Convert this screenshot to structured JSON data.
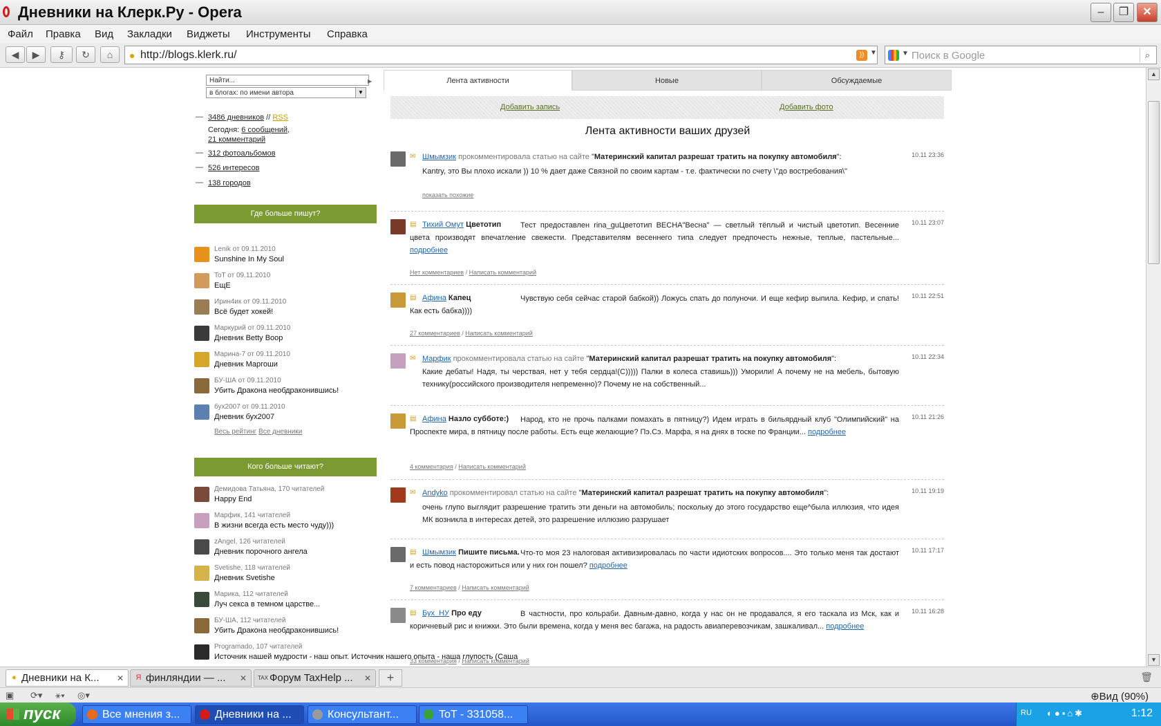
{
  "window": {
    "title": "Дневники на Клерк.Ру - Opera",
    "min": "–",
    "max": "❐",
    "close": "✕"
  },
  "menu": [
    "Файл",
    "Правка",
    "Вид",
    "Закладки",
    "Виджеты",
    "Инструменты",
    "Справка"
  ],
  "address": {
    "url": "http://blogs.klerk.ru/",
    "search_placeholder": "Поиск в Google"
  },
  "sidebar": {
    "search_placeholder": "Найти...",
    "search_mode": "в блогах: по имени автора",
    "stats": {
      "diaries": "3486 дневников",
      "sep": "//",
      "rss": "RSS",
      "today_label": "Сегодня:",
      "today_msgs": "6 сообщений",
      "today_comments": "21 комментарий",
      "albums": "312 фотоальбомов",
      "interests": "526 интересов",
      "cities": "138 городов"
    },
    "most_writing": {
      "title": "Где больше пишут?",
      "items": [
        {
          "meta": "Lenik от 09.11.2010",
          "title": "Sunshine In My Soul",
          "color": "#e8901c"
        },
        {
          "meta": "ToT от 09.11.2010",
          "title": "ЕщЕ",
          "color": "#d39a5e"
        },
        {
          "meta": "Ирин4ик от 09.11.2010",
          "title": "Всё будет хокей!",
          "color": "#9b7d55"
        },
        {
          "meta": "Маркурий от 09.11.2010",
          "title": "Дневник Betty Boop",
          "color": "#3a3a3a"
        },
        {
          "meta": "Марина-7 от 09.11.2010",
          "title": "Дневник Маргоши",
          "color": "#d9a52a"
        },
        {
          "meta": "БУ-ША от 09.11.2010",
          "title": "Убить Дракона необдраконившись!",
          "color": "#8a6a3a"
        },
        {
          "meta": "бух2007 от 09.11.2010",
          "title": "Дневник бух2007",
          "color": "#5a7fb0"
        }
      ],
      "links": [
        "Весь рейтинг",
        "Все дневники"
      ]
    },
    "most_read": {
      "title": "Кого больше читают?",
      "items": [
        {
          "meta": "Демидова Татьяна, 170 читателей",
          "title": "Happy End",
          "color": "#7a4a3a"
        },
        {
          "meta": "Марфик, 141 читателей",
          "title": "В жизни всегда есть место чуду)))",
          "color": "#c7a0c0"
        },
        {
          "meta": "zAngel, 126 читателей",
          "title": "Дневник порочного ангела",
          "color": "#4a4a4a"
        },
        {
          "meta": "Svetishe, 118 читателей",
          "title": "Дневник Svetishe",
          "color": "#d6b24a"
        },
        {
          "meta": "Марика, 112 читателей",
          "title": "Луч секса в темном царстве...",
          "color": "#3a4a3a"
        },
        {
          "meta": "БУ-ША, 112 читателей",
          "title": "Убить Дракона необдраконившись!",
          "color": "#8a6a3a"
        },
        {
          "meta": "Programado, 107 читателей",
          "title": "Источник нашей мудрости - наш опыт. Источник нашего опыта - наша глупость (Саша",
          "color": "#2a2a2a"
        }
      ]
    }
  },
  "feed": {
    "tabs": [
      "Лента активности",
      "Новые",
      "Обсуждаемые"
    ],
    "add_post": "Добавить запись",
    "add_photo": "Добавить фото",
    "title": "Лента активности ваших друзей",
    "posts": [
      {
        "author": "Шмымзик",
        "action": "прокомментировала статью на сайте",
        "subject": "Материнский капитал разрешат тратить на покупку автомобиля",
        "time": "10.11 23:36",
        "body": "Kantry, это Вы плохо искали )) 10 % дает даже Связной по своим картам - т.е. фактически по счету \\\"до востребования\\\"",
        "foot1": "показать похожие",
        "color": "#6a6a6a"
      },
      {
        "author": "Тихий Омут",
        "post_title": "Цветотип",
        "time": "10.11 23:07",
        "body": "Тест предоставлен rina_guЦветотип ВЕСНА\"Весна\" — светлый тёплый и чистый цветотип. Весенние цвета производят впечатление свежести. Представителям весеннего типа следует предпочесть нежные, теплые, пастельные...",
        "more": "подробнее",
        "foot1": "Нет комментариев",
        "foot2": "Написать комментарий",
        "color": "#7a3a2a"
      },
      {
        "author": "Афина",
        "post_title": "Капец",
        "time": "10.11 22:51",
        "body": "Чувствую себя сейчас старой бабкой)) Ложусь спать до полуночи. И еще кефир выпила. Кефир, и спать! Как есть бабка))))",
        "foot1": "27 комментариев",
        "foot2": "Написать комментарий",
        "color": "#c89a3a"
      },
      {
        "author": "Марфик",
        "action": "прокомментировала статью на сайте",
        "subject": "Материнский капитал разрешат тратить на покупку автомобиля",
        "time": "10.11 22:34",
        "body": "Какие дебаты! Надя, ты черствая, нет у тебя сердца!(С))))) Палки в колеса ставишь))) Уморили! А почему не на мебель, бытовую технику(российского производителя непременно)? Почему не на собственный...",
        "color": "#c7a0c0"
      },
      {
        "author": "Афина",
        "post_title": "Назло субботе:)",
        "time": "10.11 21:26",
        "body": "Народ, кто не прочь палками помахать в пятницу?) Идем играть в бильярдный клуб \"Олимпийский\" на Проспекте мира, в пятницу после работы. Есть еще желающие? Пэ.Сэ. Марфа, я на днях в тоске по Франции...",
        "more": "подробнее",
        "foot1": "4 комментария",
        "foot2": "Написать комментарий",
        "color": "#c89a3a"
      },
      {
        "author": "Andyko",
        "action": "прокомментировал статью на сайте",
        "subject": "Материнский капитал разрешат тратить на покупку автомобиля",
        "time": "10.11 19:19",
        "body": "очень глупо выглядит разрешение тратить эти деньги на автомобиль; поскольку до этого государство еще^была иллюзия, что идея МК возникла в интересах детей, это разрешение иллюзию разрушает",
        "color": "#a03a1a"
      },
      {
        "author": "Шмымзик",
        "post_title": "Пишите письма.",
        "time": "10.11 17:17",
        "body": "Что-то моя 23 налоговая активизировалась по части идиотских вопросов.... Это только меня так достают и есть повод насторожиться или у них гон пошел?",
        "more": "подробнее",
        "foot1": "7 комментариев",
        "foot2": "Написать комментарий",
        "color": "#6a6a6a"
      },
      {
        "author": "Бух_НУ",
        "post_title": "Про еду",
        "time": "10.11 16:28",
        "body": "В частности, про кольраби. Давным-давно, когда у нас он не продавался, я его таскала из Мск, как и коричневый рис и книжки. Это были времена, когда у меня вес багажа, на радость авиаперевозчикам, зашкаливал...",
        "more": "подробнее",
        "foot1": "33 комментария",
        "foot2": "Написать комментарий",
        "color": "#8a8a8a"
      }
    ]
  },
  "browser_tabs": [
    {
      "label": "Дневники на К...",
      "icon": "#e0a800"
    },
    {
      "label": "финляндии — ...",
      "icon": "#e03030"
    },
    {
      "label": "Форум TaxHelp ...",
      "icon": "#333"
    }
  ],
  "status": {
    "zoom": "Вид (90%)"
  },
  "taskbar": {
    "start": "пуск",
    "tasks": [
      {
        "label": "Все мнения з...",
        "icon": "#e86a1a"
      },
      {
        "label": "Дневники на ...",
        "icon": "#d61a1a"
      },
      {
        "label": "Консультант...",
        "icon": "#9a9a9a"
      },
      {
        "label": "ToT - 331058...",
        "icon": "#3aa03a"
      }
    ],
    "lang": "RU",
    "clock": "1:12"
  }
}
